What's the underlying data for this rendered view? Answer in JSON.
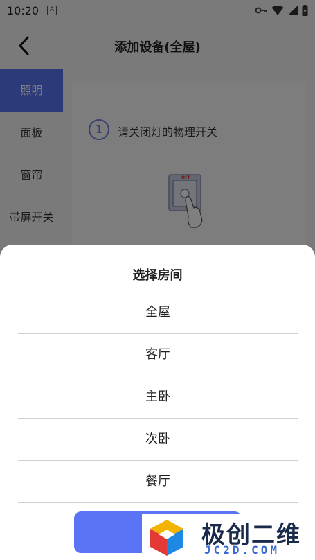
{
  "status_bar": {
    "time": "10:20",
    "app_icon_glyph": "A"
  },
  "header": {
    "title": "添加设备(全屋)"
  },
  "sidebar": {
    "items": [
      {
        "label": "照明",
        "active": true
      },
      {
        "label": "面板",
        "active": false
      },
      {
        "label": "窗帘",
        "active": false
      },
      {
        "label": "带屏开关",
        "active": false
      }
    ]
  },
  "content": {
    "step_number": "1",
    "step_text": "请关闭灯的物理开关",
    "switch_label": "OFF"
  },
  "room_sheet": {
    "title": "选择房间",
    "rooms": [
      "全屋",
      "客厅",
      "主卧",
      "次卧",
      "餐厅"
    ]
  },
  "watermark": {
    "title": "极创二维",
    "domain": "JC2D.COM"
  },
  "colors": {
    "accent": "#5a74f5",
    "overlay": "rgba(0,0,0,0.5)"
  }
}
